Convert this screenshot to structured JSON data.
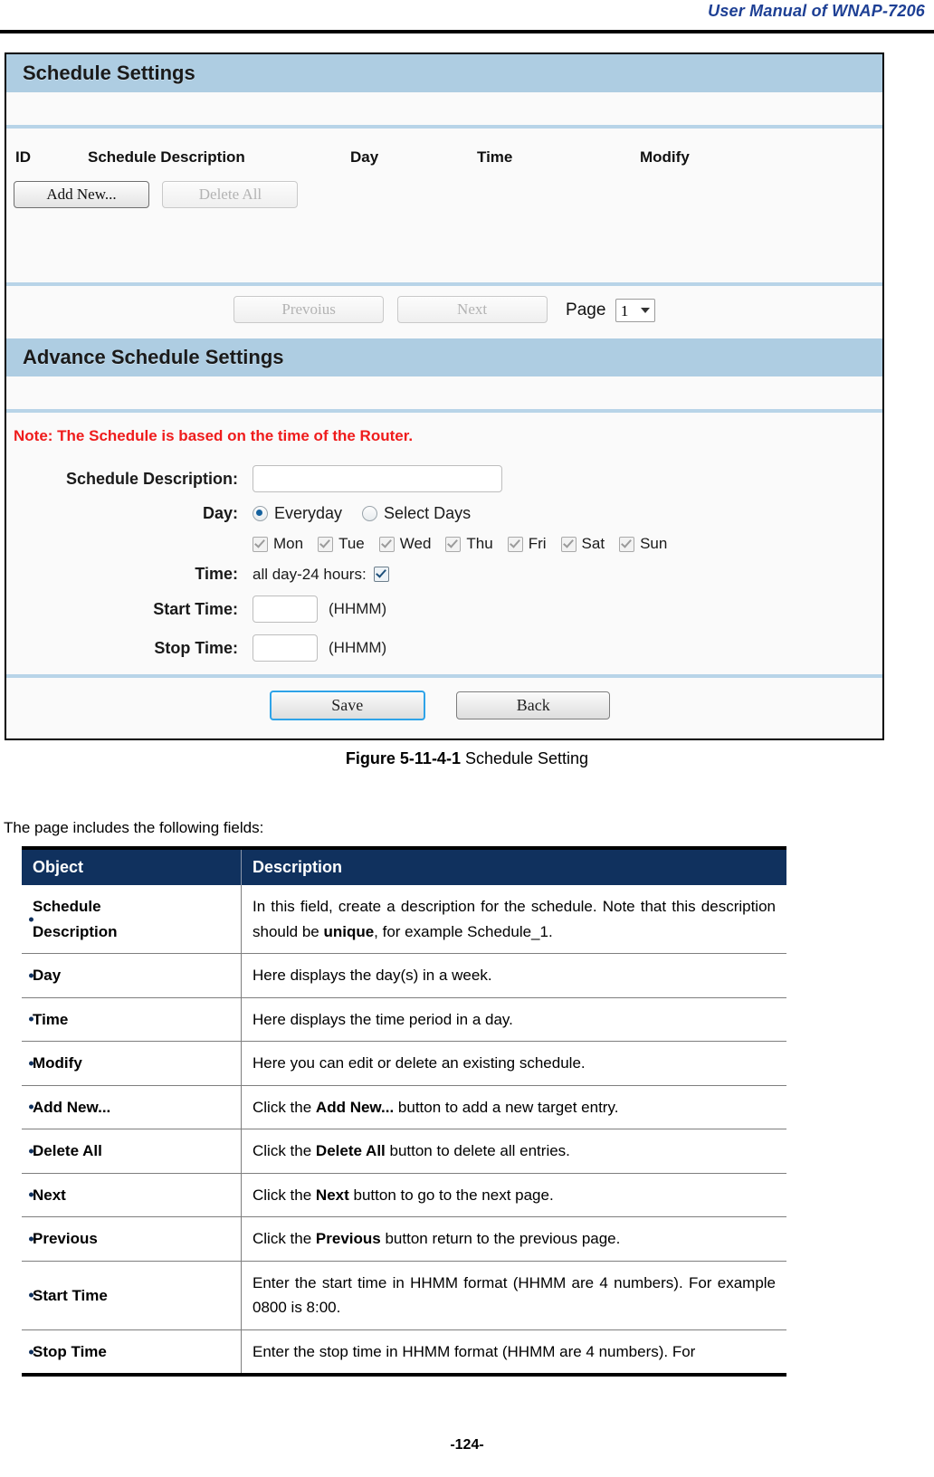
{
  "header": {
    "manual_title": "User Manual of WNAP-7206"
  },
  "screenshot": {
    "panel1_title": "Schedule Settings",
    "columns": {
      "id": "ID",
      "description": "Schedule Description",
      "day": "Day",
      "time": "Time",
      "modify": "Modify"
    },
    "buttons": {
      "add_new": "Add New...",
      "delete_all": "Delete All",
      "previous": "Prevoius",
      "next": "Next",
      "save": "Save",
      "back": "Back"
    },
    "page_label": "Page",
    "page_value": "1",
    "panel2_title": "Advance Schedule Settings",
    "note": "Note: The Schedule is based on the time of the Router.",
    "form": {
      "schedule_description_label": "Schedule Description:",
      "schedule_description_value": "",
      "day_label": "Day:",
      "radio_everyday": "Everyday",
      "radio_select_days": "Select Days",
      "days": [
        "Mon",
        "Tue",
        "Wed",
        "Thu",
        "Fri",
        "Sat",
        "Sun"
      ],
      "time_label": "Time:",
      "all_day_label": "all day-24 hours:",
      "start_time_label": "Start Time:",
      "start_time_value": "",
      "start_time_hint": "(HHMM)",
      "stop_time_label": "Stop Time:",
      "stop_time_value": "",
      "stop_time_hint": "(HHMM)"
    },
    "colors": {
      "panel_bar": "#aecde2",
      "divider": "#b8d4e8",
      "note_text": "#ef1c1c",
      "focus_ring": "#2ea3e8"
    }
  },
  "figure": {
    "number": "Figure 5-11-4-1",
    "caption": "Schedule Setting"
  },
  "body": {
    "lead_in": "The page includes the following fields:"
  },
  "spec_table": {
    "headers": {
      "object": "Object",
      "description": "Description"
    },
    "rows": [
      {
        "object": "Schedule",
        "object_line2": "Description",
        "desc_parts": [
          {
            "text": "In this field, create a description for the schedule. Note that this description should be ",
            "bold": false
          },
          {
            "text": "unique",
            "bold": true
          },
          {
            "text": ", for example Schedule_1.",
            "bold": false
          }
        ]
      },
      {
        "object": "Day",
        "object_line2": "",
        "desc_parts": [
          {
            "text": "Here displays the day(s) in a week.",
            "bold": false
          }
        ]
      },
      {
        "object": "Time",
        "object_line2": "",
        "desc_parts": [
          {
            "text": "Here displays the time period in a day.",
            "bold": false
          }
        ]
      },
      {
        "object": "Modify",
        "object_line2": "",
        "desc_parts": [
          {
            "text": "Here you can edit or delete an existing schedule.",
            "bold": false
          }
        ]
      },
      {
        "object": "Add New...",
        "object_line2": "",
        "desc_parts": [
          {
            "text": "Click the ",
            "bold": false
          },
          {
            "text": "Add New...",
            "bold": true
          },
          {
            "text": " button to add a new target entry.",
            "bold": false
          }
        ]
      },
      {
        "object": "Delete All",
        "object_line2": "",
        "desc_parts": [
          {
            "text": "Click the ",
            "bold": false
          },
          {
            "text": "Delete All",
            "bold": true
          },
          {
            "text": " button to delete all entries.",
            "bold": false
          }
        ]
      },
      {
        "object": "Next",
        "object_line2": "",
        "desc_parts": [
          {
            "text": "Click the ",
            "bold": false
          },
          {
            "text": "Next",
            "bold": true
          },
          {
            "text": " button to go to the next page.",
            "bold": false
          }
        ]
      },
      {
        "object": "Previous",
        "object_line2": "",
        "desc_parts": [
          {
            "text": "Click the ",
            "bold": false
          },
          {
            "text": "Previous",
            "bold": true
          },
          {
            "text": " button return to the previous page.",
            "bold": false
          }
        ]
      },
      {
        "object": "Start Time",
        "object_line2": "",
        "desc_parts": [
          {
            "text": "Enter the start time in HHMM format (HHMM are 4 numbers). For example 0800 is 8:00.",
            "bold": false
          }
        ]
      },
      {
        "object": "Stop Time",
        "object_line2": "",
        "desc_parts": [
          {
            "text": "Enter the stop time in HHMM format (HHMM are 4 numbers). For",
            "bold": false
          }
        ]
      }
    ]
  },
  "footer": {
    "page_number": "-124-"
  }
}
